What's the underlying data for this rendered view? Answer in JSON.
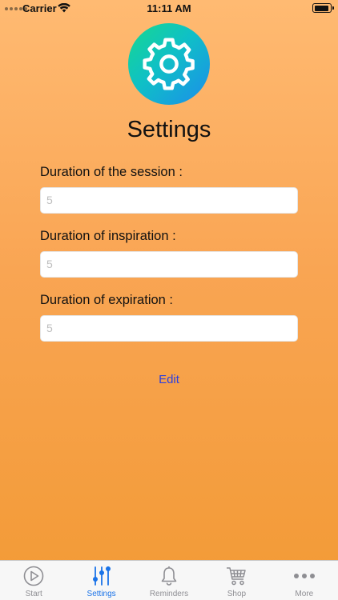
{
  "status_bar": {
    "carrier": "Carrier",
    "time": "11:11 AM"
  },
  "page": {
    "title": "Settings"
  },
  "fields": [
    {
      "label": "Duration of the session :",
      "placeholder": "5"
    },
    {
      "label": "Duration of inspiration :",
      "placeholder": "5"
    },
    {
      "label": "Duration of expiration :",
      "placeholder": "5"
    }
  ],
  "edit_label": "Edit",
  "tabs": [
    {
      "label": "Start",
      "icon": "play-circle-icon",
      "active": false
    },
    {
      "label": "Settings",
      "icon": "sliders-icon",
      "active": true
    },
    {
      "label": "Reminders",
      "icon": "bell-icon",
      "active": false
    },
    {
      "label": "Shop",
      "icon": "cart-icon",
      "active": false
    },
    {
      "label": "More",
      "icon": "more-dots-icon",
      "active": false
    }
  ],
  "colors": {
    "accent": "#1A73E8",
    "edit": "#2C3FE0",
    "inactive_tab": "#8E8E93"
  }
}
